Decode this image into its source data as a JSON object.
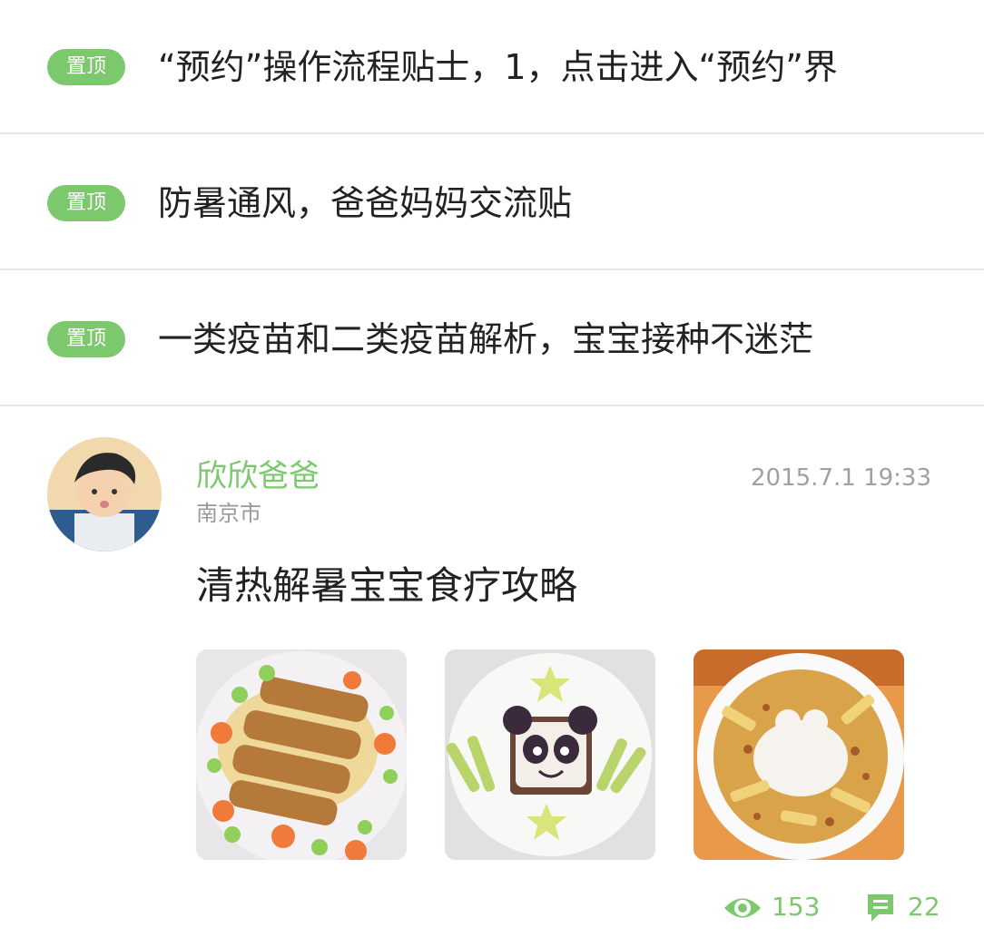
{
  "pinned": [
    {
      "badge": "置顶",
      "title": "“预约”操作流程贴士，1，点击进入“预约”界"
    },
    {
      "badge": "置顶",
      "title": "防暑通风，爸爸妈妈交流贴"
    },
    {
      "badge": "置顶",
      "title": "一类疫苗和二类疫苗解析，宝宝接种不迷茫"
    }
  ],
  "post": {
    "author": "欣欣爸爸",
    "location": "南京市",
    "timestamp": "2015.7.1 19:33",
    "title": "清热解暑宝宝食疗攻略",
    "views": "153",
    "comments": "22"
  },
  "colors": {
    "accent": "#7cc96d",
    "divider": "#e6e6e6",
    "text": "#222222",
    "muted": "#999999"
  }
}
